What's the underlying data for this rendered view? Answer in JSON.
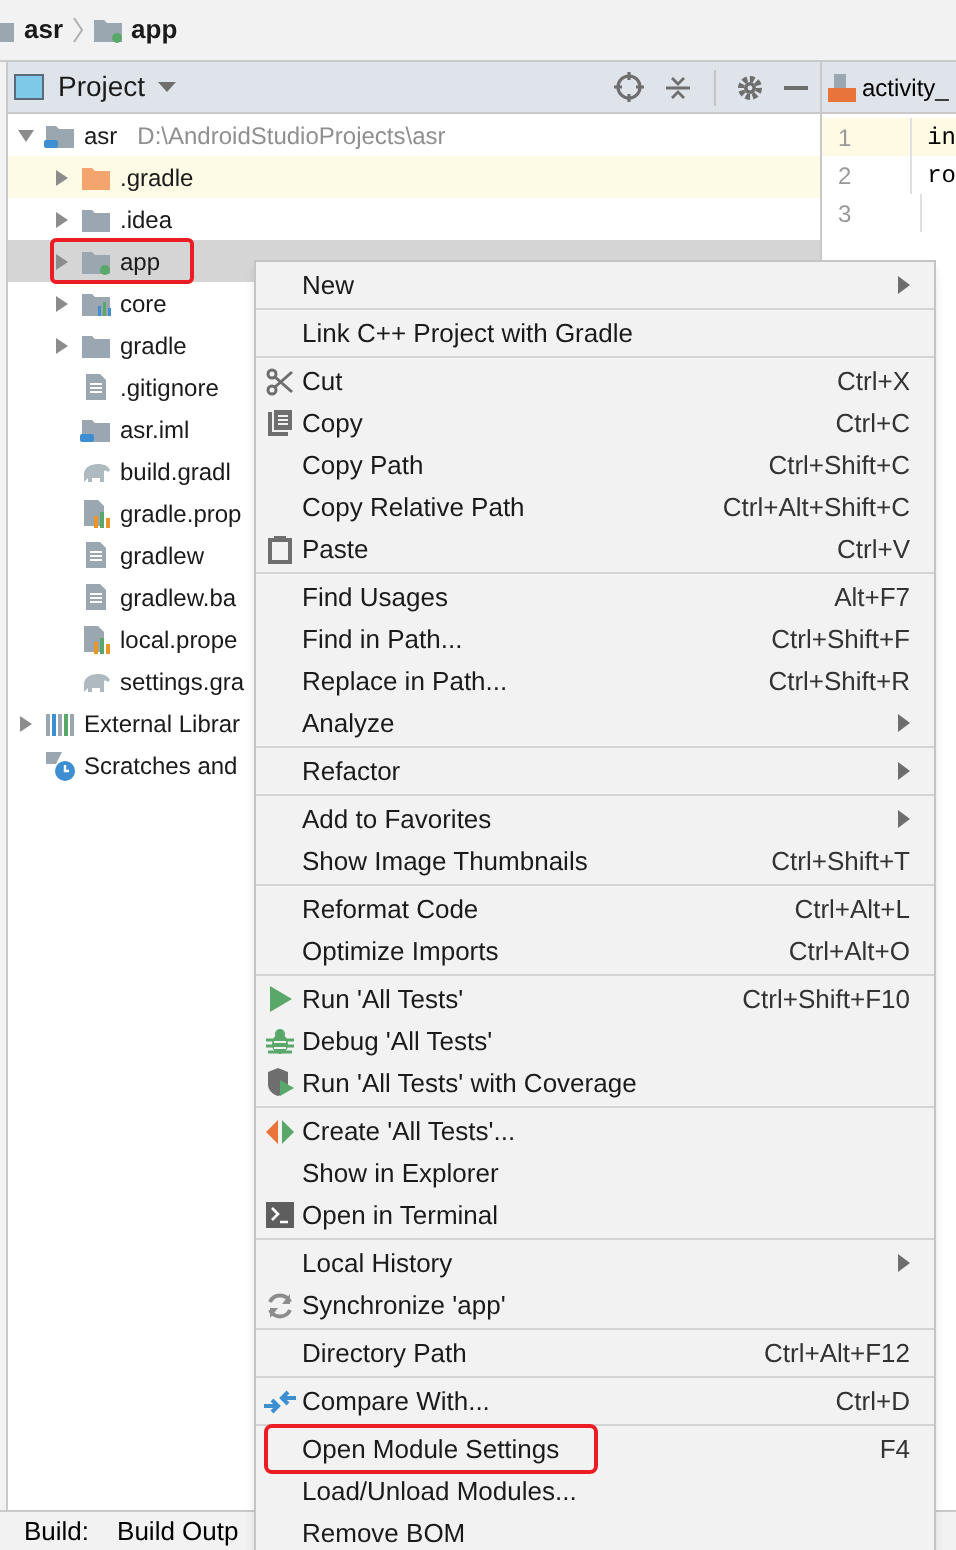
{
  "breadcrumb": [
    {
      "label": "asr",
      "kind": "module"
    },
    {
      "label": "app",
      "kind": "app"
    }
  ],
  "project_panel": {
    "title": "Project",
    "tree": [
      {
        "label": "asr",
        "hint": "D:\\AndroidStudioProjects\\asr",
        "kind": "module",
        "expanded": true,
        "selected": false,
        "highlighted": false,
        "annotated": false,
        "children": [
          {
            "label": ".gradle",
            "kind": "folder-orange",
            "expanded": false,
            "selected": false,
            "highlighted": true,
            "annotated": false
          },
          {
            "label": ".idea",
            "kind": "folder",
            "expanded": false,
            "selected": false,
            "highlighted": false,
            "annotated": false
          },
          {
            "label": "app",
            "kind": "app",
            "expanded": false,
            "selected": true,
            "annotated": true
          },
          {
            "label": "core",
            "kind": "lib",
            "expanded": false,
            "selected": false,
            "highlighted": false,
            "annotated": false
          },
          {
            "label": "gradle",
            "kind": "folder",
            "expanded": false,
            "selected": false,
            "highlighted": false,
            "annotated": false
          },
          {
            "label": ".gitignore",
            "kind": "file",
            "selected": false,
            "highlighted": false,
            "annotated": false
          },
          {
            "label": "asr.iml",
            "kind": "iml",
            "selected": false,
            "highlighted": false,
            "annotated": false
          },
          {
            "label": "build.gradl",
            "kind": "gradle",
            "selected": false,
            "highlighted": false,
            "annotated": false
          },
          {
            "label": "gradle.prop",
            "kind": "props",
            "selected": false,
            "highlighted": false,
            "annotated": false
          },
          {
            "label": "gradlew",
            "kind": "file",
            "selected": false,
            "highlighted": false,
            "annotated": false
          },
          {
            "label": "gradlew.ba",
            "kind": "file",
            "selected": false,
            "highlighted": false,
            "annotated": false
          },
          {
            "label": "local.prope",
            "kind": "props",
            "selected": false,
            "highlighted": false,
            "annotated": false
          },
          {
            "label": "settings.gra",
            "kind": "gradle",
            "selected": false,
            "highlighted": false,
            "annotated": false
          }
        ]
      },
      {
        "label": "External Librar",
        "kind": "libs",
        "expanded": false,
        "selected": false,
        "highlighted": false,
        "annotated": false
      },
      {
        "label": "Scratches and",
        "kind": "scratch",
        "selected": false,
        "highlighted": false,
        "annotated": false
      }
    ]
  },
  "editor": {
    "tab": "activity_",
    "lines": [
      {
        "number": "1",
        "code": "in",
        "current": true
      },
      {
        "number": "2",
        "code": "ro",
        "current": false
      },
      {
        "number": "3",
        "current": false
      }
    ]
  },
  "context_menu": [
    [
      {
        "label": "New",
        "kind": "plain",
        "submenu": true
      }
    ],
    [
      {
        "label": "Link C++ Project with Gradle",
        "kind": "plain"
      }
    ],
    [
      {
        "label": "Cut",
        "kind": "cut",
        "shortcut": "Ctrl+X"
      },
      {
        "label": "Copy",
        "kind": "copy",
        "shortcut": "Ctrl+C"
      },
      {
        "label": "Copy Path",
        "kind": "plain",
        "shortcut": "Ctrl+Shift+C"
      },
      {
        "label": "Copy Relative Path",
        "kind": "plain",
        "shortcut": "Ctrl+Alt+Shift+C"
      },
      {
        "label": "Paste",
        "kind": "paste",
        "shortcut": "Ctrl+V"
      }
    ],
    [
      {
        "label": "Find Usages",
        "kind": "plain",
        "shortcut": "Alt+F7"
      },
      {
        "label": "Find in Path...",
        "kind": "plain",
        "shortcut": "Ctrl+Shift+F"
      },
      {
        "label": "Replace in Path...",
        "kind": "plain",
        "shortcut": "Ctrl+Shift+R"
      },
      {
        "label": "Analyze",
        "kind": "plain",
        "submenu": true
      }
    ],
    [
      {
        "label": "Refactor",
        "kind": "plain",
        "submenu": true
      }
    ],
    [
      {
        "label": "Add to Favorites",
        "kind": "plain",
        "submenu": true
      },
      {
        "label": "Show Image Thumbnails",
        "kind": "plain",
        "shortcut": "Ctrl+Shift+T"
      }
    ],
    [
      {
        "label": "Reformat Code",
        "kind": "plain",
        "shortcut": "Ctrl+Alt+L"
      },
      {
        "label": "Optimize Imports",
        "kind": "plain",
        "shortcut": "Ctrl+Alt+O"
      }
    ],
    [
      {
        "label": "Run 'All Tests'",
        "kind": "run",
        "shortcut": "Ctrl+Shift+F10"
      },
      {
        "label": "Debug 'All Tests'",
        "kind": "debug"
      },
      {
        "label": "Run 'All Tests' with Coverage",
        "kind": "coverage"
      }
    ],
    [
      {
        "label": "Create 'All Tests'...",
        "kind": "create"
      },
      {
        "label": "Show in Explorer",
        "kind": "plain"
      },
      {
        "label": "Open in Terminal",
        "kind": "terminal"
      }
    ],
    [
      {
        "label": "Local History",
        "kind": "plain",
        "submenu": true
      },
      {
        "label": "Synchronize 'app'",
        "kind": "sync"
      }
    ],
    [
      {
        "label": "Directory Path",
        "kind": "plain",
        "shortcut": "Ctrl+Alt+F12"
      }
    ],
    [
      {
        "label": "Compare With...",
        "kind": "compare",
        "shortcut": "Ctrl+D"
      }
    ],
    [
      {
        "label": "Open Module Settings",
        "kind": "plain",
        "shortcut": "F4",
        "annotated": true
      },
      {
        "label": "Load/Unload Modules...",
        "kind": "plain"
      },
      {
        "label": "Remove BOM",
        "kind": "plain"
      }
    ]
  ],
  "bottom_bar": {
    "label": "Build:",
    "tab": "Build Outp"
  }
}
